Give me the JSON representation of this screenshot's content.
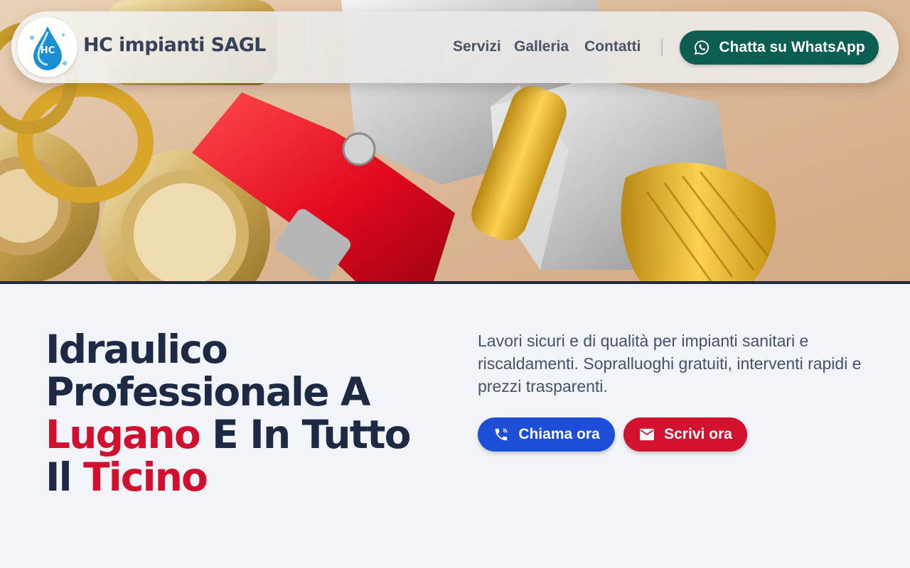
{
  "colors": {
    "brand_text": "#36425a",
    "headline": "#1e2a44",
    "accent_red": "#d0102e",
    "whatsapp_green": "#0c5e52",
    "call_blue": "#1d4ed8",
    "mail_red": "#d31230",
    "page_bg": "#f1f4f8"
  },
  "header": {
    "logo_icon": "water-drop-logo-icon",
    "brand_name": "HC impianti SAGL",
    "nav": [
      {
        "label": "Servizi"
      },
      {
        "label": "Galleria"
      },
      {
        "label": "Contatti"
      }
    ],
    "whatsapp": {
      "icon": "whatsapp-icon",
      "label": "Chatta su WhatsApp"
    }
  },
  "hero": {
    "image": "plumbing-fittings-photo"
  },
  "main": {
    "headline": {
      "part1": "Idraulico Professionale A ",
      "highlight1": "Lugano",
      "part2": " E In Tutto Il ",
      "highlight2": "Ticino"
    },
    "lead": "Lavori sicuri e di qualità per impianti sanitari e riscaldamenti. Sopralluoghi gratuiti, interventi rapidi e prezzi trasparenti.",
    "buttons": {
      "call": {
        "icon": "phone-icon",
        "label": "Chiama ora"
      },
      "mail": {
        "icon": "mail-icon",
        "label": "Scrivi ora"
      }
    }
  }
}
